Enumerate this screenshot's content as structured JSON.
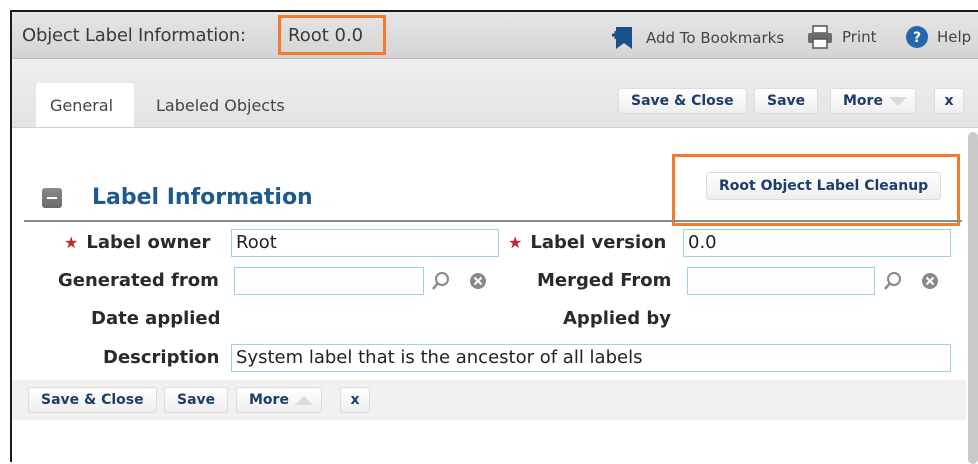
{
  "window": {
    "title_prefix": "Object Label Information:",
    "title_value": "Root 0.0",
    "toolbar": {
      "bookmarks": "Add To Bookmarks",
      "print": "Print",
      "help": "Help"
    }
  },
  "tabs": [
    "General",
    "Labeled Objects"
  ],
  "actions": {
    "save_close": "Save & Close",
    "save": "Save",
    "more": "More",
    "close": "x"
  },
  "section": {
    "title": "Label Information",
    "cleanup_button": "Root Object Label Cleanup"
  },
  "form": {
    "label_owner": {
      "label": "Label owner",
      "value": "Root"
    },
    "label_version": {
      "label": "Label version",
      "value": "0.0"
    },
    "generated_from": {
      "label": "Generated from",
      "value": ""
    },
    "merged_from": {
      "label": "Merged From",
      "value": ""
    },
    "date_applied": {
      "label": "Date applied"
    },
    "applied_by": {
      "label": "Applied by"
    },
    "description": {
      "label": "Description",
      "value": "System label that is the ancestor of all labels"
    }
  },
  "colors": {
    "highlight": "#f47a2e",
    "accent": "#1f5a8c",
    "required": "#c0272d",
    "field_border": "#9ed0e6"
  }
}
